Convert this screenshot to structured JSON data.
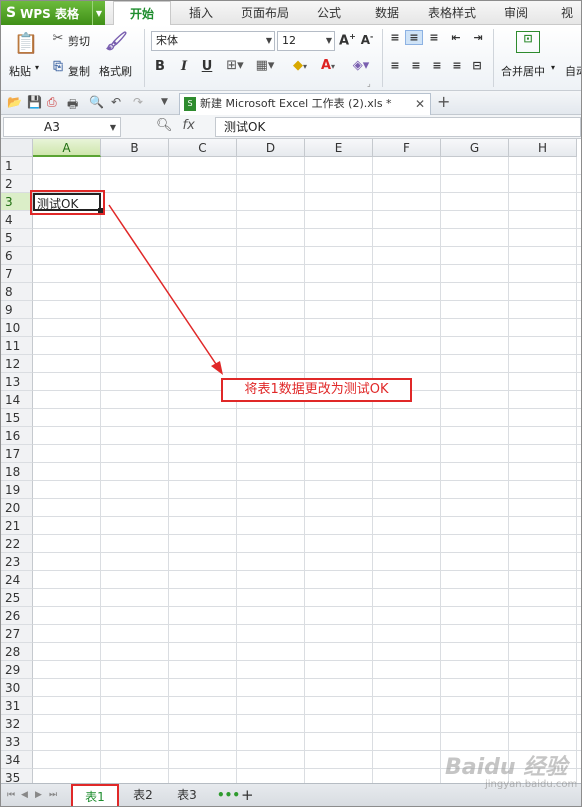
{
  "app": {
    "name": "WPS 表格",
    "logo": "S"
  },
  "tabs": [
    "开始",
    "插入",
    "页面布局",
    "公式",
    "数据",
    "表格样式",
    "审阅",
    "视图"
  ],
  "active_tab": "开始",
  "ribbon": {
    "paste": "粘贴",
    "cut": "剪切",
    "copy": "复制",
    "format_painter": "格式刷",
    "font_name": "宋体",
    "font_size": "12",
    "merge_center": "合并居中",
    "auto_wrap": "自动"
  },
  "document_tab": "新建 Microsoft Excel 工作表 (2).xls *",
  "name_box": "A3",
  "formula_content": "测试OK",
  "columns": [
    "A",
    "B",
    "C",
    "D",
    "E",
    "F",
    "G",
    "H"
  ],
  "rows": [
    "1",
    "2",
    "3",
    "4",
    "5",
    "6",
    "7",
    "8",
    "9",
    "10",
    "11",
    "12",
    "13",
    "14",
    "15",
    "16",
    "17",
    "18",
    "19",
    "20",
    "21",
    "22",
    "23",
    "24",
    "25",
    "26",
    "27",
    "28",
    "29",
    "30",
    "31",
    "32",
    "33",
    "34",
    "35"
  ],
  "cell_value": "测试OK",
  "annotation": "将表1数据更改为测试OK",
  "sheets": [
    "表1",
    "表2",
    "表3"
  ],
  "active_sheet": "表1",
  "watermark": "Baidu 经验",
  "watermark_url": "jingyan.baidu.com",
  "colors": {
    "accent_green": "#3f8f17",
    "highlight_red": "#e02828"
  }
}
